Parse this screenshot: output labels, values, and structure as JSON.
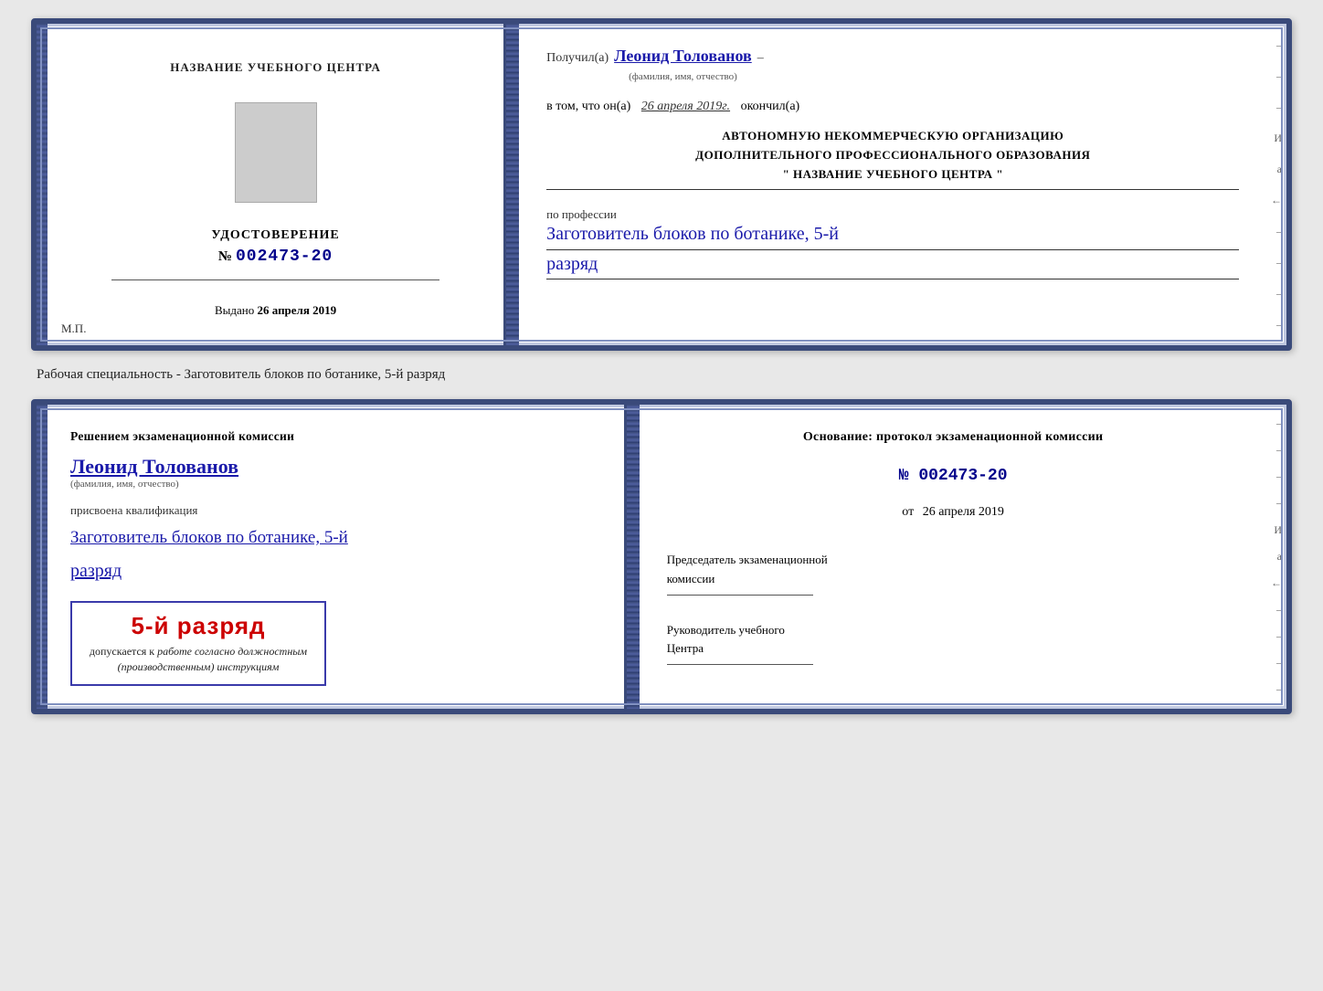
{
  "top_document": {
    "left": {
      "title": "НАЗВАНИЕ УЧЕБНОГО ЦЕНТРА",
      "photo_alt": "photo",
      "cert_title": "УДОСТОВЕРЕНИЕ",
      "cert_number_prefix": "№",
      "cert_number": "002473-20",
      "issued_label": "Выдано",
      "issued_date": "26 апреля 2019",
      "stamp_label": "М.П."
    },
    "right": {
      "received_prefix": "Получил(а)",
      "recipient_name": "Леонид Толованов",
      "name_subtitle": "(фамилия, имя, отчество)",
      "date_prefix": "в том, что он(а)",
      "date_value": "26 апреля 2019г.",
      "date_suffix": "окончил(а)",
      "org_line1": "АВТОНОМНУЮ НЕКОММЕРЧЕСКУЮ ОРГАНИЗАЦИЮ",
      "org_line2": "ДОПОЛНИТЕЛЬНОГО ПРОФЕССИОНАЛЬНОГО ОБРАЗОВАНИЯ",
      "org_line3": "\"  НАЗВАНИЕ УЧЕБНОГО ЦЕНТРА  \"",
      "profession_label": "по профессии",
      "profession_value": "Заготовитель блоков по ботанике, 5-й",
      "razryad_value": "разряд",
      "dashes": [
        "–",
        "–",
        "–",
        "И",
        "а",
        "←",
        "–",
        "–",
        "–",
        "–"
      ]
    }
  },
  "between_label": "Рабочая специальность - Заготовитель блоков по ботанике, 5-й разряд",
  "bottom_document": {
    "left": {
      "decision_text": "Решением экзаменационной комиссии",
      "person_name": "Леонид Толованов",
      "name_subtitle": "(фамилия, имя, отчество)",
      "qual_label": "присвоена квалификация",
      "qual_value": "Заготовитель блоков по ботанике, 5-й",
      "razryad_value": "разряд",
      "stamp_big": "5-й разряд",
      "stamp_allowed": "допускается к",
      "stamp_work": "работе согласно должностным",
      "stamp_instructions": "(производственным) инструкциям"
    },
    "right": {
      "osnov_label": "Основание: протокол экзаменационной комиссии",
      "protocol_prefix": "№",
      "protocol_number": "002473-20",
      "from_prefix": "от",
      "from_date": "26 апреля 2019",
      "chairman_label": "Председатель экзаменационной",
      "chairman_label2": "комиссии",
      "head_label": "Руководитель учебного",
      "head_label2": "Центра",
      "dashes": [
        "–",
        "–",
        "–",
        "–",
        "И",
        "а",
        "←",
        "–",
        "–",
        "–",
        "–"
      ]
    }
  }
}
